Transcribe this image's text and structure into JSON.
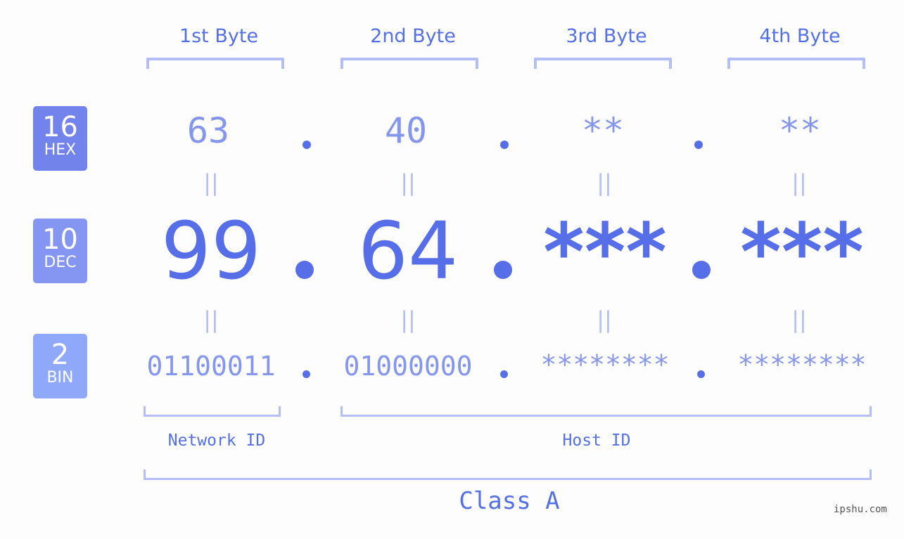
{
  "bytes": [
    {
      "label": "1st Byte",
      "hex": "63",
      "dec": "99",
      "bin": "01100011"
    },
    {
      "label": "2nd Byte",
      "hex": "40",
      "dec": "64",
      "bin": "01000000"
    },
    {
      "label": "3rd Byte",
      "hex": "**",
      "dec": "***",
      "bin": "********"
    },
    {
      "label": "4th Byte",
      "hex": "**",
      "dec": "***",
      "bin": "********"
    }
  ],
  "rows": {
    "hex": {
      "base": "16",
      "name": "HEX",
      "color": "#7383ec"
    },
    "dec": {
      "base": "10",
      "name": "DEC",
      "color": "#8596f2"
    },
    "bin": {
      "base": "2",
      "name": "BIN",
      "color": "#8fa8fa"
    }
  },
  "equals_symbol": "||",
  "network_id_label": "Network ID",
  "host_id_label": "Host ID",
  "class_label": "Class A",
  "watermark": "ipshu.com",
  "colors": {
    "accent": "#566ee8",
    "light": "#8596ee",
    "bracket": "#b3bef7"
  }
}
